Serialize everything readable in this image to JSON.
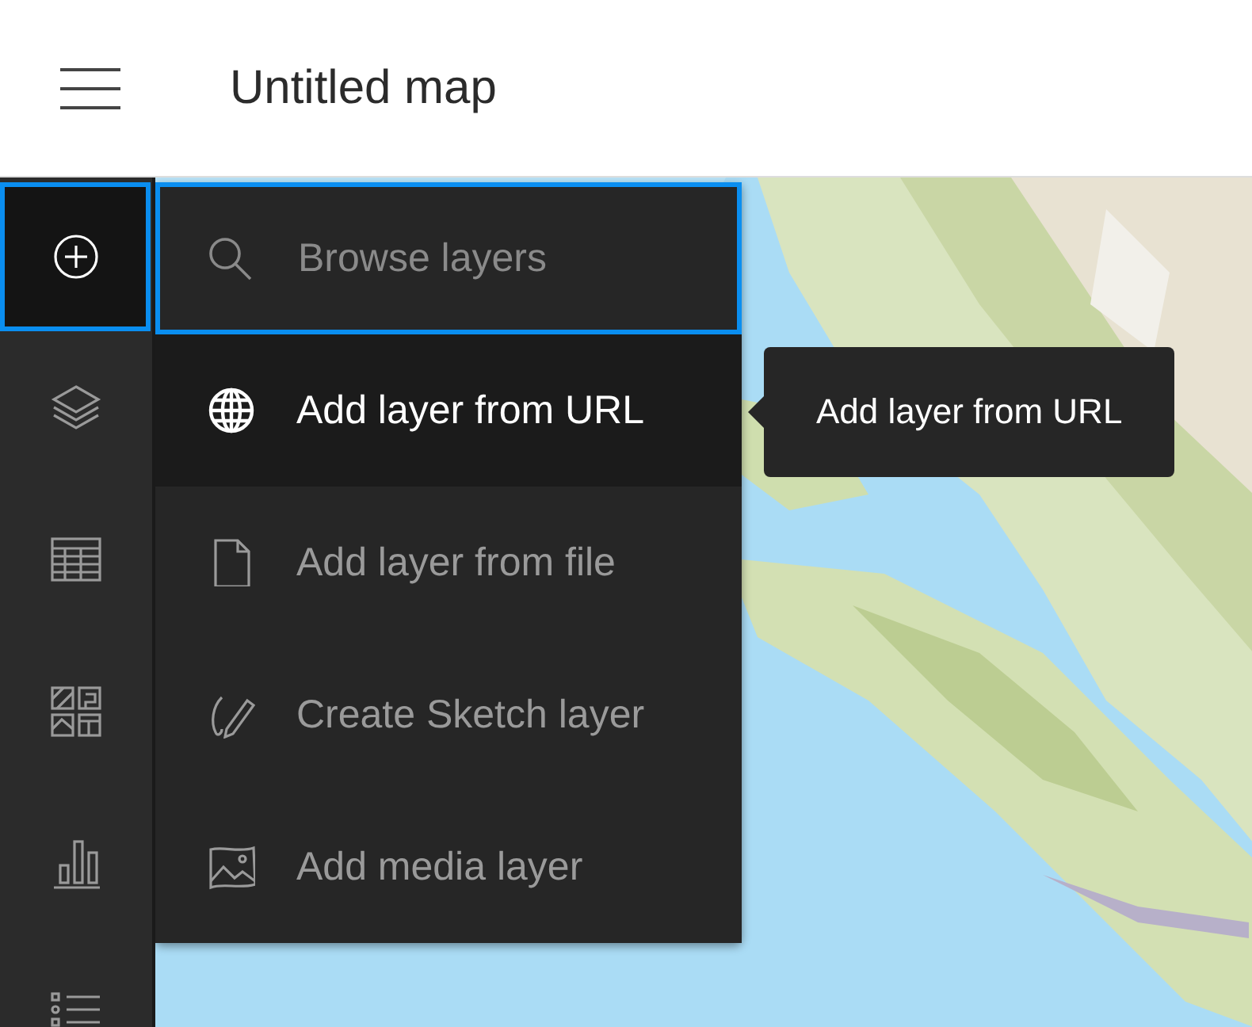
{
  "header": {
    "title": "Untitled map"
  },
  "toolbar": {
    "items": [
      {
        "selected": true
      },
      {
        "selected": false
      },
      {
        "selected": false
      },
      {
        "selected": false
      },
      {
        "selected": false
      },
      {
        "selected": false
      }
    ]
  },
  "add_menu": {
    "search": {
      "placeholder": "Browse layers",
      "focused": true
    },
    "items": [
      {
        "label": "Add layer from URL",
        "highlighted": true
      },
      {
        "label": "Add layer from file",
        "highlighted": false
      },
      {
        "label": "Create Sketch layer",
        "highlighted": false
      },
      {
        "label": "Add media layer",
        "highlighted": false
      }
    ]
  },
  "tooltip": {
    "text": "Add layer from URL"
  }
}
